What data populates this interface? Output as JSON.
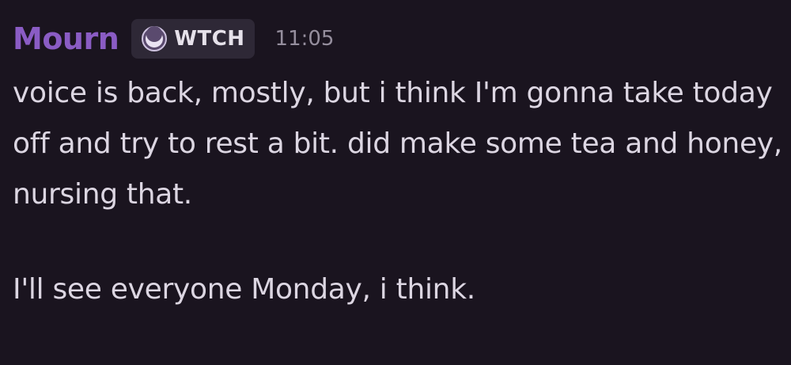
{
  "message": {
    "author": "Mourn",
    "author_color": "#8a5cc4",
    "tag": {
      "icon": "moon-icon",
      "label": "WTCH"
    },
    "timestamp": "11:05",
    "paragraphs": [
      "voice is back, mostly, but i think I'm gonna take today off and try to rest a bit. did make some tea and honey, nursing that.",
      "I'll see everyone Monday, i think."
    ]
  }
}
